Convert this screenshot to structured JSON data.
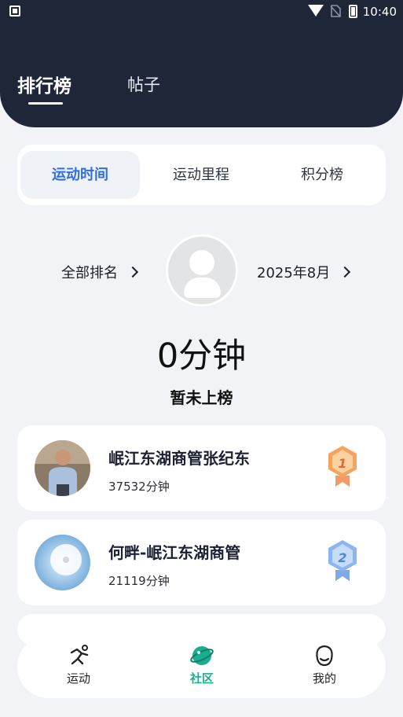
{
  "status_bar": {
    "time": "10:40"
  },
  "header": {
    "tabs": [
      {
        "label": "排行榜",
        "active": true
      },
      {
        "label": "帖子",
        "active": false
      }
    ]
  },
  "segments": [
    {
      "label": "运动时间",
      "active": true
    },
    {
      "label": "运动里程",
      "active": false
    },
    {
      "label": "积分榜",
      "active": false
    }
  ],
  "summary": {
    "scope_label": "全部排名",
    "period_label": "2025年8月",
    "my_score": "0分钟",
    "rank_status": "暂未上榜"
  },
  "ranking": [
    {
      "name": "岷江东湖商管张纪东",
      "minutes": "37532分钟",
      "rank": 1
    },
    {
      "name": "何畔-岷江东湖商管",
      "minutes": "21119分钟",
      "rank": 2
    }
  ],
  "bottom_nav": [
    {
      "label": "运动",
      "icon": "run-icon",
      "active": false
    },
    {
      "label": "社区",
      "icon": "planet-icon",
      "active": true
    },
    {
      "label": "我的",
      "icon": "face-icon",
      "active": false
    }
  ],
  "colors": {
    "header_bg": "#1e2638",
    "accent_blue": "#2f6ee5",
    "accent_green": "#1aae8f"
  }
}
